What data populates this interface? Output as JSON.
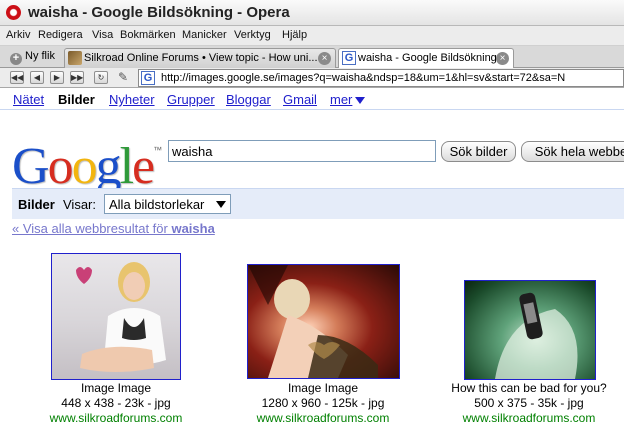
{
  "window": {
    "title": "waisha - Google Bildsökning - Opera"
  },
  "menu": {
    "items": [
      "Arkiv",
      "Redigera",
      "Visa",
      "Bokmärken",
      "Manicker",
      "Verktyg",
      "Hjälp"
    ]
  },
  "tabs": {
    "new_tab": "Ny flik",
    "items": [
      {
        "label": "Silkroad Online Forums • View topic - How uni..."
      },
      {
        "label": "waisha - Google Bildsökning"
      }
    ]
  },
  "address": {
    "url": "http://images.google.se/images?q=waisha&ndsp=18&um=1&hl=sv&start=72&sa=N"
  },
  "gbar": {
    "items": [
      "Nätet",
      "Bilder",
      "Nyheter",
      "Grupper",
      "Bloggar",
      "Gmail"
    ],
    "more": "mer"
  },
  "search": {
    "query": "waisha",
    "search_images_button": "Sök bilder",
    "search_web_button": "Sök hela webbe"
  },
  "filter": {
    "section_label": "Bilder",
    "showing_label": "Visar:",
    "size_selected": "Alla bildstorlekar"
  },
  "back_link": {
    "prefix": "« Visa alla webbresultat för ",
    "query": "waisha"
  },
  "results": [
    {
      "title": "Image Image",
      "meta": "448 x 438 - 23k - jpg",
      "site": "www.silkroadforums.com"
    },
    {
      "title": "Image Image",
      "meta": "1280 x 960 - 125k - jpg",
      "site": "www.silkroadforums.com"
    },
    {
      "title": "How this can be bad for you?",
      "meta": "500 x 375 - 35k - jpg",
      "site": "www.silkroadforums.com"
    }
  ],
  "logo": {
    "text": "Google",
    "tm": "™"
  },
  "icons": {
    "opera": "opera-logo-icon",
    "new_tab": "plus-icon",
    "tab_close": "close-icon",
    "back": "back-icon",
    "forward": "forward-icon",
    "rewind": "rewind-icon",
    "fast_forward": "fast-forward-icon",
    "reload": "reload-icon",
    "edit": "pencil-icon",
    "dropdown": "chevron-down-icon"
  },
  "colors": {
    "link": "#2020cc",
    "visited": "#7777cc",
    "url_green": "#008000",
    "filter_bar": "#e5ecf9"
  }
}
